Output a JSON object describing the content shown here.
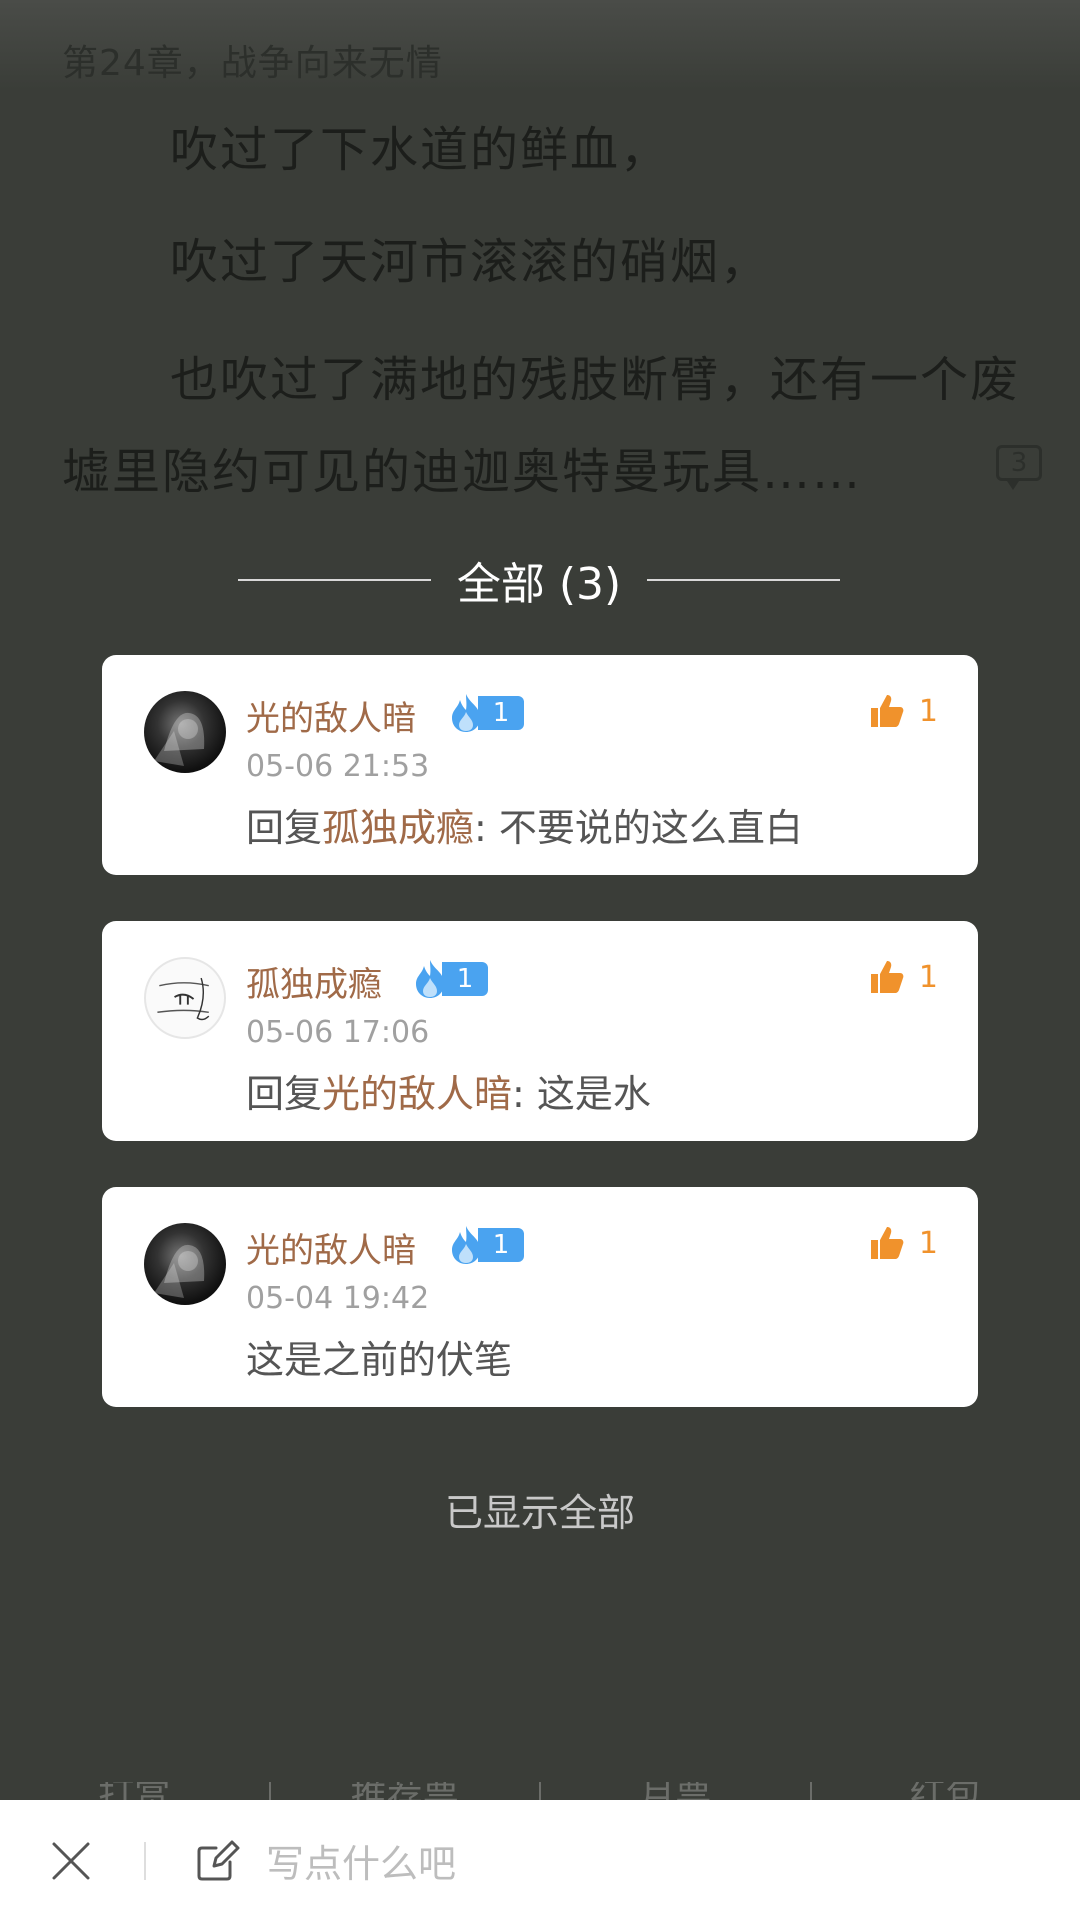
{
  "reader": {
    "chapter_title": "第24章，战争向来无情",
    "paragraphs": [
      "吹过了下水道的鲜血，",
      "吹过了天河市滚滚的硝烟，",
      "也吹过了满地的残肢断臂，还有一个废墟里隐约可见的迪迦奥特曼玩具……"
    ],
    "comment_count_mark": "3"
  },
  "comments_panel": {
    "header": "全部 (3)",
    "comments": [
      {
        "username": "光的敌人暗",
        "level": "1",
        "time": "05-06 21:53",
        "reply_prefix": "回复",
        "reply_to": "孤独成瘾",
        "text": ": 不要说的这么直白",
        "likes": "1"
      },
      {
        "username": "孤独成瘾",
        "level": "1",
        "time": "05-06 17:06",
        "reply_prefix": "回复",
        "reply_to": "光的敌人暗",
        "text": ": 这是水",
        "likes": "1"
      },
      {
        "username": "光的敌人暗",
        "level": "1",
        "time": "05-04 19:42",
        "text": "这是之前的伏笔",
        "likes": "1"
      }
    ],
    "footer_text": "已显示全部"
  },
  "ghost_tabs": [
    "打赏",
    "推荐票",
    "月票",
    "红包"
  ],
  "bottom_bar": {
    "close_icon": "close-icon",
    "compose_icon": "edit-icon",
    "placeholder": "写点什么吧"
  },
  "colors": {
    "background_overlay": "#3a3d38",
    "username": "#a06a48",
    "like": "#f0922c",
    "badge": "#4aa3f0"
  }
}
